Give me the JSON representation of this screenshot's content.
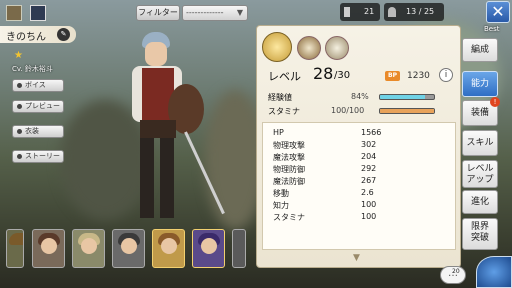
{
  "top": {
    "filter_label": "フィルター",
    "dropdown_value": "-------------",
    "counter1": "21",
    "counter2": "13 / 25",
    "best_label": "Best"
  },
  "character": {
    "name": "きのちん",
    "cv": "Cv. 鈴木裕斗",
    "rarity": "★",
    "buttons": [
      "ボイス",
      "プレビュー",
      "衣装",
      "ストーリー"
    ]
  },
  "panel": {
    "level_label": "レベル",
    "level": "28",
    "level_max": "/30",
    "bp_label": "BP",
    "bp_value": "1230",
    "info": "i",
    "exp_label": "経験値",
    "exp_value": "84%",
    "exp_fraction": 0.84,
    "stamina_label": "スタミナ",
    "stamina_value": "100/100",
    "stamina_fraction": 1.0,
    "stats": [
      {
        "k": "HP",
        "v": "1566"
      },
      {
        "k": "物理攻撃",
        "v": "302"
      },
      {
        "k": "魔法攻撃",
        "v": "204"
      },
      {
        "k": "物理防御",
        "v": "292"
      },
      {
        "k": "魔法防御",
        "v": "267"
      },
      {
        "k": "移動",
        "v": "2.6"
      },
      {
        "k": "知力",
        "v": "100"
      },
      {
        "k": "スタミナ",
        "v": "100"
      }
    ]
  },
  "tabs": [
    {
      "label": "編成",
      "active": false
    },
    {
      "label": "能力",
      "active": true
    },
    {
      "label": "装備",
      "active": false,
      "badge": "!"
    },
    {
      "label": "スキル",
      "active": false
    },
    {
      "label": "レベル\nアップ",
      "active": false
    },
    {
      "label": "進化",
      "active": false
    },
    {
      "label": "限界\n突破",
      "active": false
    }
  ],
  "colors": {
    "exp_bar": "#6fd2e6",
    "stamina_bar": "#e8a25a",
    "active_tab": "#3a7fd0",
    "badge": "#e0451f"
  },
  "chat_count": "20"
}
